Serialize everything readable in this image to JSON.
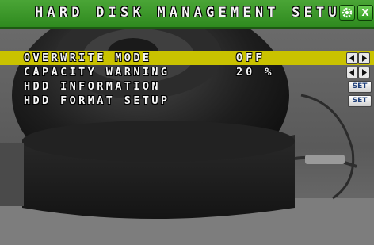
{
  "window": {
    "title": "HARD DISK MANAGEMENT SETUP",
    "buttons": [
      {
        "name": "settings-button",
        "icon": "gear-icon"
      },
      {
        "name": "close-button",
        "icon": "close-icon",
        "glyph": "X"
      }
    ],
    "titlebar_color": "#3a9a28"
  },
  "menu": {
    "items": [
      {
        "label": "OVERWRITE MODE",
        "value": "OFF",
        "control": "arrows",
        "selected": true
      },
      {
        "label": "CAPACITY WARNING",
        "value": "20 %",
        "control": "arrows",
        "selected": false
      },
      {
        "label": "HDD INFORMATION",
        "value": "",
        "control": "set",
        "control_label": "SET",
        "selected": false
      },
      {
        "label": "HDD FORMAT SETUP",
        "value": "",
        "control": "set",
        "control_label": "SET",
        "selected": false
      }
    ],
    "selected_color": "#c9c200"
  }
}
